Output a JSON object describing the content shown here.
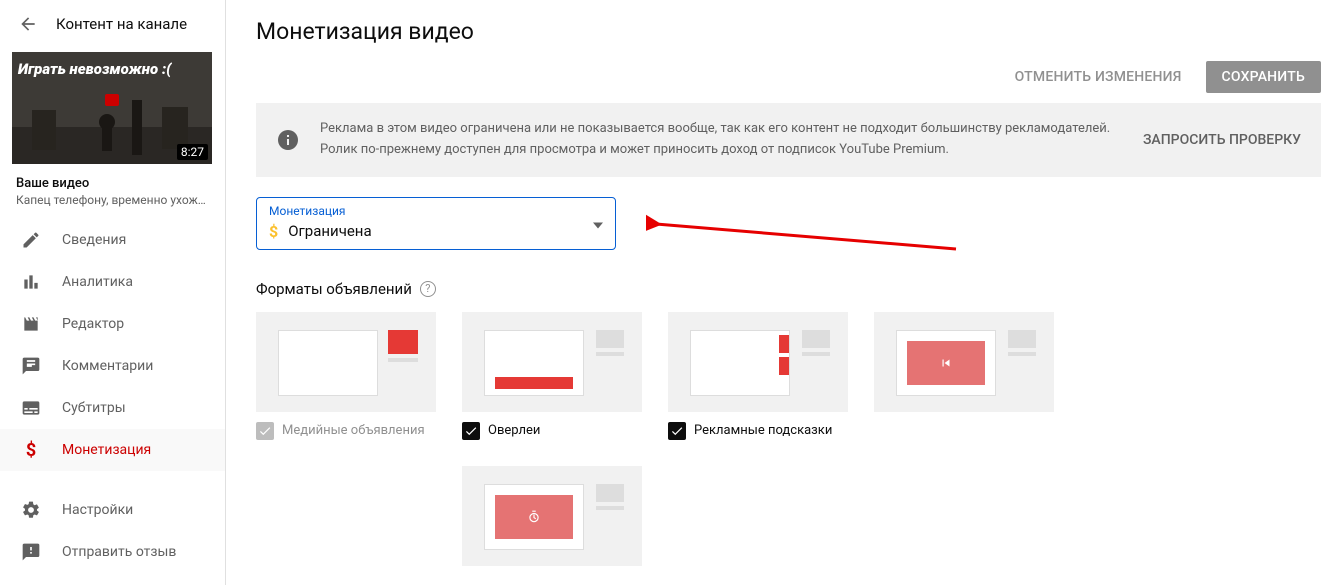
{
  "sidebar": {
    "back_label": "Контент на канале",
    "thumb_text": "Играть невозможно :(",
    "duration": "8:27",
    "your_video_label": "Ваше видео",
    "video_subtitle": "Капец телефону, временно ухожу ...",
    "nav": [
      {
        "label": "Сведения"
      },
      {
        "label": "Аналитика"
      },
      {
        "label": "Редактор"
      },
      {
        "label": "Комментарии"
      },
      {
        "label": "Субтитры"
      },
      {
        "label": "Монетизация"
      },
      {
        "label": "Настройки"
      },
      {
        "label": "Отправить отзыв"
      }
    ]
  },
  "main": {
    "title": "Монетизация видео",
    "cancel": "ОТМЕНИТЬ ИЗМЕНЕНИЯ",
    "save": "СОХРАНИТЬ",
    "banner_text": "Реклама в этом видео ограничена или не показывается вообще, так как его контент не подходит большинству рекламодателей. Ролик по-прежнему доступен для просмотра и может приносить доход от подписок YouTube Premium.",
    "banner_action": "ЗАПРОСИТЬ ПРОВЕРКУ",
    "select": {
      "label": "Монетизация",
      "value": "Ограничена"
    },
    "formats_title": "Форматы объявлений",
    "ads": [
      {
        "label": "Медийные объявления"
      },
      {
        "label": "Оверлеи"
      },
      {
        "label": "Рекламные подсказки"
      }
    ]
  }
}
